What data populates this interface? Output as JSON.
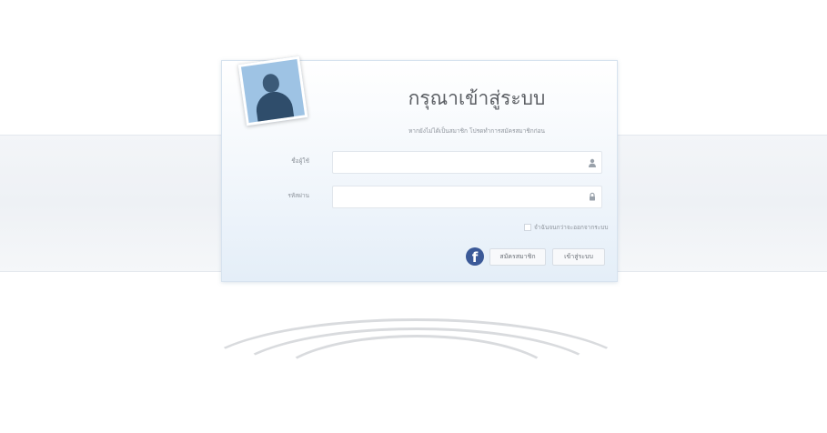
{
  "login": {
    "title": "กรุณาเข้าสู่ระบบ",
    "subtitle": "หากยังไม่ได้เป็นสมาชิก โปรดทำการสมัครสมาชิกก่อน",
    "username_label": "ชื่อผู้ใช้",
    "username_value": "",
    "password_label": "รหัสผ่าน",
    "password_value": "",
    "remember_label": "จำฉันจนกว่าจะออกจากระบบ",
    "register_button": "สมัครสมาชิก",
    "login_button": "เข้าสู่ระบบ",
    "facebook_glyph": "f"
  },
  "icons": {
    "user": "user-icon",
    "lock": "lock-icon",
    "facebook": "facebook-icon",
    "avatar": "avatar-photo"
  },
  "colors": {
    "facebook": "#3b5998",
    "card_gradient_bottom": "#e4eef8",
    "title_text": "#5c5f64"
  }
}
